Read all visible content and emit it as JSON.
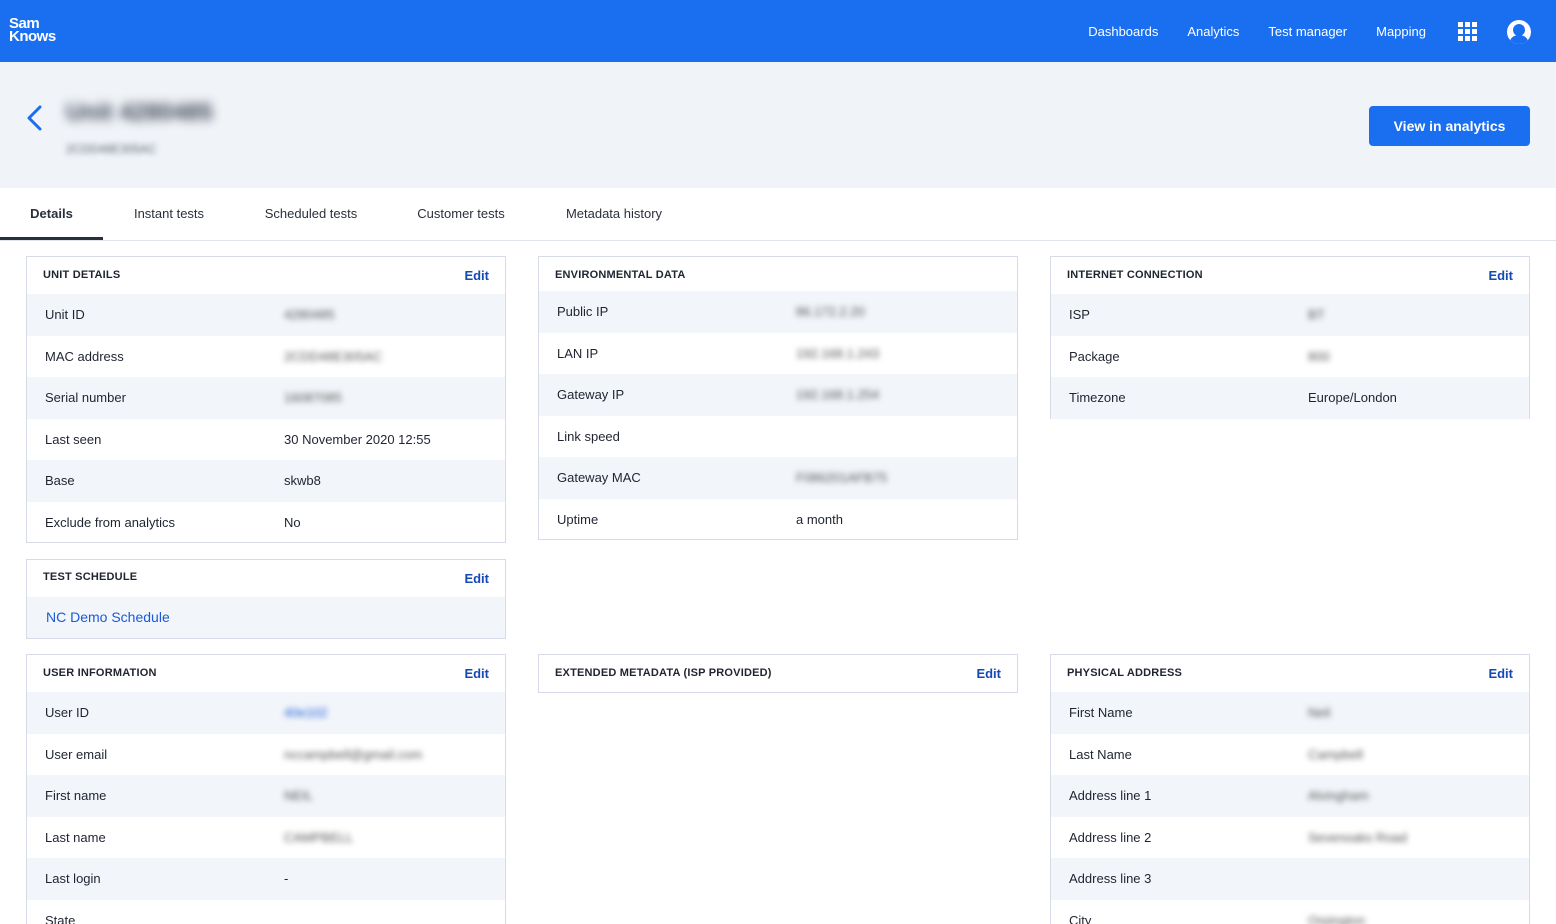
{
  "brand": {
    "line1": "Sam",
    "line2": "Knows"
  },
  "nav": [
    "Dashboards",
    "Analytics",
    "Test manager",
    "Mapping"
  ],
  "icons": {
    "apps": "apps-grid-icon",
    "profile": "user-avatar-icon",
    "back": "chevron-left-icon"
  },
  "header": {
    "title": "Unit 4280485",
    "subtitle": "2CDD48E305AC",
    "view_button": "View in analytics"
  },
  "tabs": [
    "Details",
    "Instant tests",
    "Scheduled tests",
    "Customer tests",
    "Metadata history"
  ],
  "unit_details": {
    "title": "UNIT DETAILS",
    "edit": "Edit",
    "rows": [
      {
        "label": "Unit ID",
        "value": "4280485"
      },
      {
        "label": "MAC address",
        "value": "2CDD48E305AC"
      },
      {
        "label": "Serial number",
        "value": "16087085"
      },
      {
        "label": "Last seen",
        "value": "30 November 2020 12:55"
      },
      {
        "label": "Base",
        "value": "skwb8"
      },
      {
        "label": "Exclude from analytics",
        "value": "No"
      }
    ]
  },
  "environmental": {
    "title": "ENVIRONMENTAL DATA",
    "rows": [
      {
        "label": "Public IP",
        "value": "86.172.2.20"
      },
      {
        "label": "LAN IP",
        "value": "192.168.1.243"
      },
      {
        "label": "Gateway IP",
        "value": "192.168.1.254"
      },
      {
        "label": "Link speed",
        "value": ""
      },
      {
        "label": "Gateway MAC",
        "value": "F086201AFB75"
      },
      {
        "label": "Uptime",
        "value": "a month"
      }
    ]
  },
  "internet": {
    "title": "INTERNET CONNECTION",
    "edit": "Edit",
    "rows": [
      {
        "label": "ISP",
        "value": "BT"
      },
      {
        "label": "Package",
        "value": "800"
      },
      {
        "label": "Timezone",
        "value": "Europe/London"
      }
    ]
  },
  "test_schedule": {
    "title": "TEST SCHEDULE",
    "edit": "Edit",
    "link": "NC Demo Schedule"
  },
  "user_info": {
    "title": "USER INFORMATION",
    "edit": "Edit",
    "rows": [
      {
        "label": "User ID",
        "value": "40e102"
      },
      {
        "label": "User email",
        "value": "nccampbell@gmail.com"
      },
      {
        "label": "First name",
        "value": "NEIL"
      },
      {
        "label": "Last name",
        "value": "CAMPBELL"
      },
      {
        "label": "Last login",
        "value": "-"
      },
      {
        "label": "State",
        "value": ""
      }
    ]
  },
  "extended": {
    "title": "EXTENDED METADATA (ISP PROVIDED)",
    "edit": "Edit"
  },
  "physical": {
    "title": "PHYSICAL ADDRESS",
    "edit": "Edit",
    "rows": [
      {
        "label": "First Name",
        "value": "Neil"
      },
      {
        "label": "Last Name",
        "value": "Campbell"
      },
      {
        "label": "Address line 1",
        "value": "Alvingham"
      },
      {
        "label": "Address line 2",
        "value": "Sevenoaks Road"
      },
      {
        "label": "Address line 3",
        "value": ""
      },
      {
        "label": "City",
        "value": "Orpington"
      }
    ]
  }
}
